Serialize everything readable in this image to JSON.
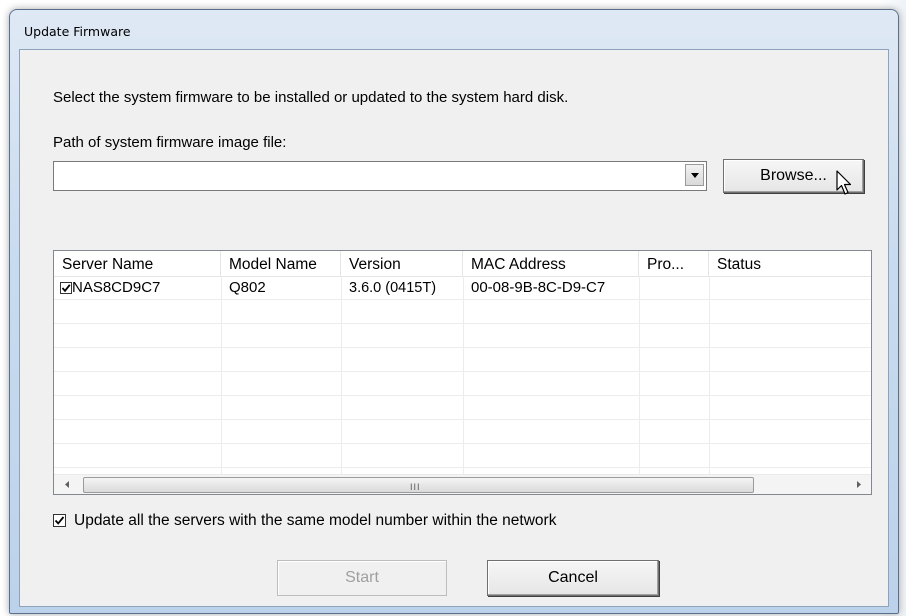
{
  "window": {
    "title": "Update Firmware"
  },
  "dialog": {
    "instruction": "Select the system firmware to be installed or updated to the system hard disk.",
    "path_label": "Path of system firmware image file:",
    "path_value": "",
    "browse_label": "Browse...",
    "columns": [
      "Server Name",
      "Model Name",
      "Version",
      "MAC Address",
      "Pro...",
      "Status"
    ],
    "rows": [
      {
        "checked": true,
        "server_name": "NAS8CD9C7",
        "model_name": "Q802",
        "version": "3.6.0 (0415T)",
        "mac": "00-08-9B-8C-D9-C7",
        "progress": "",
        "status": ""
      }
    ],
    "scroll_grip": "III",
    "update_all_label": "Update all the servers with the same model number within the network",
    "update_all_checked": true,
    "start_label": "Start",
    "start_enabled": false,
    "cancel_label": "Cancel"
  },
  "icons": {
    "combo_arrow": "triangle-down-icon",
    "scroll_left": "triangle-left-icon",
    "scroll_right": "triangle-right-icon",
    "check": "checkmark-icon",
    "cursor": "mouse-pointer-icon"
  }
}
